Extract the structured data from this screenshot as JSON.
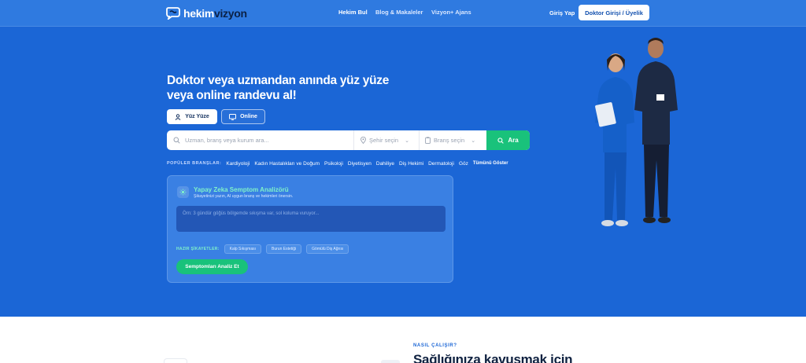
{
  "brand": {
    "name_part1": "hekim",
    "name_part2": "vizyon"
  },
  "nav": {
    "items": [
      "Hekim Bul",
      "Blog & Makaleler",
      "Vizyon+ Ajans"
    ],
    "login": "Giriş Yap",
    "doctor_login": "Doktor Girişi / Üyelik"
  },
  "hero": {
    "headline_line1": "Doktor veya uzmandan anında yüz yüze",
    "headline_line2": "veya online randevu al!",
    "mode_face": "Yüz Yüze",
    "mode_online": "Online",
    "search": {
      "placeholder": "Uzman, branş veya kurum ara...",
      "city": "Şehir seçin",
      "branch": "Branş seçin",
      "button": "Ara"
    },
    "popular_label": "POPÜLER BRANŞLAR:",
    "popular": [
      "Kardiyoloji",
      "Kadın Hastalıkları ve Doğum",
      "Psikoloji",
      "Diyetisyen",
      "Dahiliye",
      "Diş Hekimi",
      "Dermatoloji",
      "Göz"
    ],
    "show_all": "Tümünü Göster"
  },
  "ai": {
    "title": "Yapay Zeka Semptom Analizörü",
    "subtitle": "Şikayetinizi yazın, AI uygun branş ve hekimleri önersin.",
    "placeholder": "Örn: 3 gündür göğüs bölgemde sıkışma var, sol koluma vuruyor...",
    "ready_label": "HAZIR ŞİKAYETLER:",
    "chips": [
      "Kalp Sıkışması",
      "Burun Estetiği",
      "Gömülü Diş Ağrısı"
    ],
    "button": "Semptomları Analiz Et"
  },
  "how": {
    "label": "NASIL ÇALIŞIR?",
    "title": "Sağlığınıza kavuşmak için"
  },
  "colors": {
    "primary": "#1b66d6",
    "accent": "#19c27b",
    "dark": "#0f2140"
  }
}
